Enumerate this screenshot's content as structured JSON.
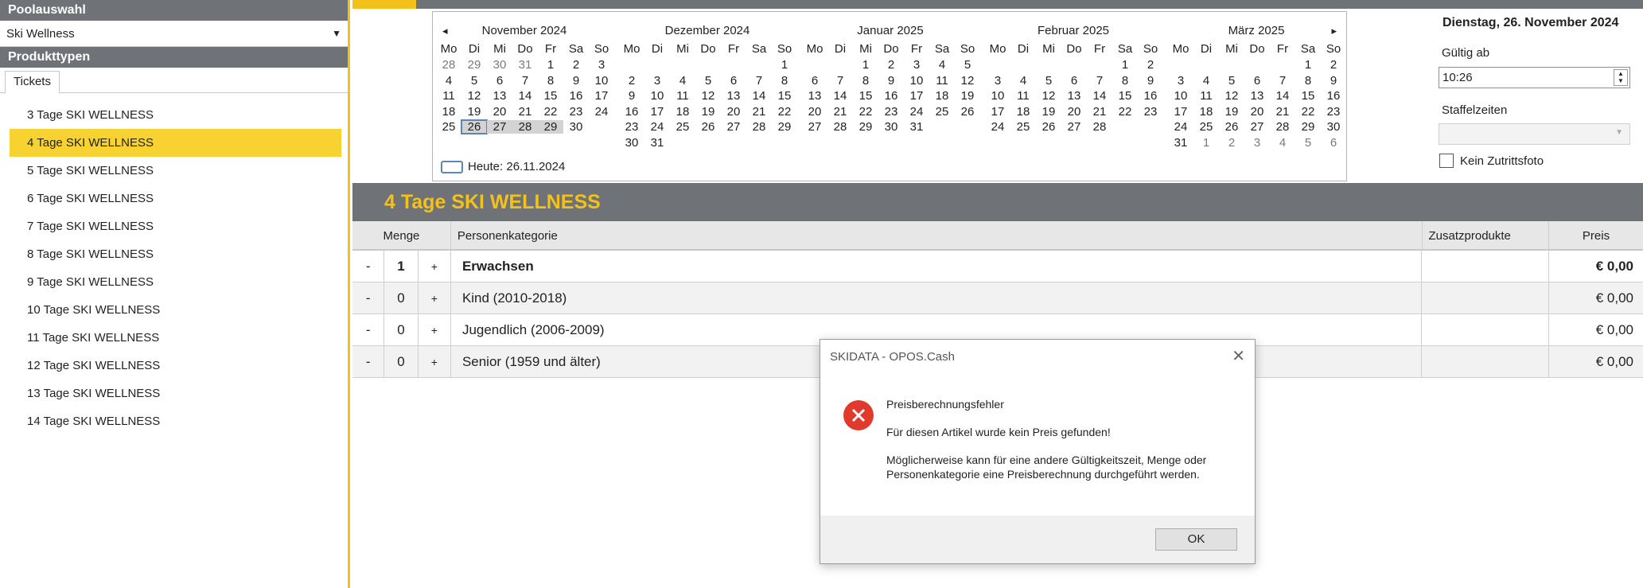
{
  "sidebar": {
    "pool_header": "Poolauswahl",
    "pool_selected": "Ski Wellness",
    "product_header": "Produkttypen",
    "tab_tickets": "Tickets",
    "tickets": [
      "3 Tage SKI WELLNESS",
      "4 Tage SKI WELLNESS",
      "5 Tage SKI WELLNESS",
      "6 Tage SKI WELLNESS",
      "7 Tage SKI WELLNESS",
      "8 Tage SKI WELLNESS",
      "9 Tage SKI WELLNESS",
      "10 Tage SKI WELLNESS",
      "11 Tage SKI WELLNESS",
      "12 Tage SKI WELLNESS",
      "13 Tage SKI WELLNESS",
      "14 Tage SKI WELLNESS"
    ],
    "selected_ticket": "4 Tage SKI WELLNESS"
  },
  "calendar": {
    "nav_prev": "◂",
    "nav_next": "▸",
    "weekdays": [
      "Mo",
      "Di",
      "Mi",
      "Do",
      "Fr",
      "Sa",
      "So"
    ],
    "months": [
      {
        "title": "November 2024",
        "rows": [
          [
            "28",
            "29",
            "30",
            "31",
            "1",
            "2",
            "3"
          ],
          [
            "4",
            "5",
            "6",
            "7",
            "8",
            "9",
            "10"
          ],
          [
            "11",
            "12",
            "13",
            "14",
            "15",
            "16",
            "17"
          ],
          [
            "18",
            "19",
            "20",
            "21",
            "22",
            "23",
            "24"
          ],
          [
            "25",
            "26",
            "27",
            "28",
            "29",
            "30",
            ""
          ]
        ]
      },
      {
        "title": "Dezember 2024",
        "rows": [
          [
            "",
            "",
            "",
            "",
            "",
            "",
            "1"
          ],
          [
            "2",
            "3",
            "4",
            "5",
            "6",
            "7",
            "8"
          ],
          [
            "9",
            "10",
            "11",
            "12",
            "13",
            "14",
            "15"
          ],
          [
            "16",
            "17",
            "18",
            "19",
            "20",
            "21",
            "22"
          ],
          [
            "23",
            "24",
            "25",
            "26",
            "27",
            "28",
            "29"
          ],
          [
            "30",
            "31",
            "",
            "",
            "",
            "",
            ""
          ]
        ]
      },
      {
        "title": "Januar 2025",
        "rows": [
          [
            "",
            "",
            "1",
            "2",
            "3",
            "4",
            "5"
          ],
          [
            "6",
            "7",
            "8",
            "9",
            "10",
            "11",
            "12"
          ],
          [
            "13",
            "14",
            "15",
            "16",
            "17",
            "18",
            "19"
          ],
          [
            "20",
            "21",
            "22",
            "23",
            "24",
            "25",
            "26"
          ],
          [
            "27",
            "28",
            "29",
            "30",
            "31",
            "",
            ""
          ]
        ]
      },
      {
        "title": "Februar 2025",
        "rows": [
          [
            "",
            "",
            "",
            "",
            "",
            "1",
            "2"
          ],
          [
            "3",
            "4",
            "5",
            "6",
            "7",
            "8",
            "9"
          ],
          [
            "10",
            "11",
            "12",
            "13",
            "14",
            "15",
            "16"
          ],
          [
            "17",
            "18",
            "19",
            "20",
            "21",
            "22",
            "23"
          ],
          [
            "24",
            "25",
            "26",
            "27",
            "28",
            "",
            ""
          ]
        ]
      },
      {
        "title": "März 2025",
        "rows": [
          [
            "",
            "",
            "",
            "",
            "",
            "1",
            "2"
          ],
          [
            "3",
            "4",
            "5",
            "6",
            "7",
            "8",
            "9"
          ],
          [
            "10",
            "11",
            "12",
            "13",
            "14",
            "15",
            "16"
          ],
          [
            "17",
            "18",
            "19",
            "20",
            "21",
            "22",
            "23"
          ],
          [
            "24",
            "25",
            "26",
            "27",
            "28",
            "29",
            "30"
          ],
          [
            "31",
            "1",
            "2",
            "3",
            "4",
            "5",
            "6"
          ]
        ]
      }
    ],
    "today_label": "Heute: 26.11.2024"
  },
  "info": {
    "date_heading": "Dienstag, 26. November 2024",
    "gueltig_label": "Gültig ab",
    "time_value": "10:26",
    "staffel_label": "Staffelzeiten",
    "foto_label": "Kein Zutrittsfoto"
  },
  "product": {
    "title": "4 Tage SKI WELLNESS"
  },
  "table": {
    "col_menge": "Menge",
    "col_kategorie": "Personenkategorie",
    "col_zusatz": "Zusatzprodukte",
    "col_preis": "Preis",
    "rows": [
      {
        "minus": "-",
        "qty": "1",
        "plus": "+",
        "category": "Erwachsen",
        "price": "€ 0,00"
      },
      {
        "minus": "-",
        "qty": "0",
        "plus": "+",
        "category": "Kind (2010-2018)",
        "price": "€ 0,00"
      },
      {
        "minus": "-",
        "qty": "0",
        "plus": "+",
        "category": "Jugendlich (2006-2009)",
        "price": "€ 0,00"
      },
      {
        "minus": "-",
        "qty": "0",
        "plus": "+",
        "category": "Senior (1959 und älter)",
        "price": "€ 0,00"
      }
    ]
  },
  "dialog": {
    "title": "SKIDATA - OPOS.Cash",
    "close": "✕",
    "heading": "Preisberechnungsfehler",
    "message": "Für diesen Artikel wurde kein Preis gefunden!",
    "hint": "Möglicherweise kann für eine andere Gültigkeitszeit, Menge oder Personenkategorie eine Preisberechnung durchgeführt werden.",
    "ok_label": "OK",
    "icon": "error-icon",
    "icon_color": "#e13a2c"
  },
  "colors": {
    "accent": "#f2c21a",
    "header_gray": "#6f7276",
    "selection": "#f7d230"
  }
}
